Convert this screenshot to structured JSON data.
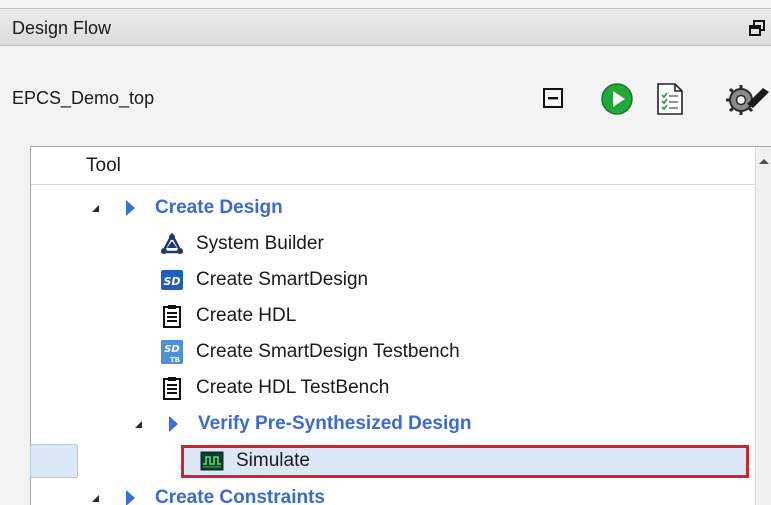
{
  "panel": {
    "title": "Design Flow",
    "module_name": "EPCS_Demo_top"
  },
  "toolbar": {
    "icons": [
      "collapse-all-icon",
      "run-icon",
      "report-icon",
      "options-icon"
    ]
  },
  "tree": {
    "column_header": "Tool",
    "items": [
      {
        "label": "Create Design",
        "type": "group"
      },
      {
        "label": "System Builder",
        "type": "tool",
        "icon": "system-builder-icon"
      },
      {
        "label": "Create SmartDesign",
        "type": "tool",
        "icon": "smartdesign-icon",
        "badge": "SD"
      },
      {
        "label": "Create HDL",
        "type": "tool",
        "icon": "hdl-document-icon"
      },
      {
        "label": "Create SmartDesign Testbench",
        "type": "tool",
        "icon": "smartdesign-testbench-icon",
        "badge": "SD",
        "badge_sub": "TB"
      },
      {
        "label": "Create HDL TestBench",
        "type": "tool",
        "icon": "hdl-document-icon"
      },
      {
        "label": "Verify Pre-Synthesized Design",
        "type": "group"
      },
      {
        "label": "Simulate",
        "type": "tool",
        "icon": "simulate-icon",
        "selected": true
      },
      {
        "label": "Create Constraints",
        "type": "group"
      }
    ]
  },
  "colors": {
    "group_text": "#3a6ad9",
    "highlight_border": "#d8202a",
    "selection_fill": "#dce8f8",
    "run_green": "#22a83a"
  }
}
